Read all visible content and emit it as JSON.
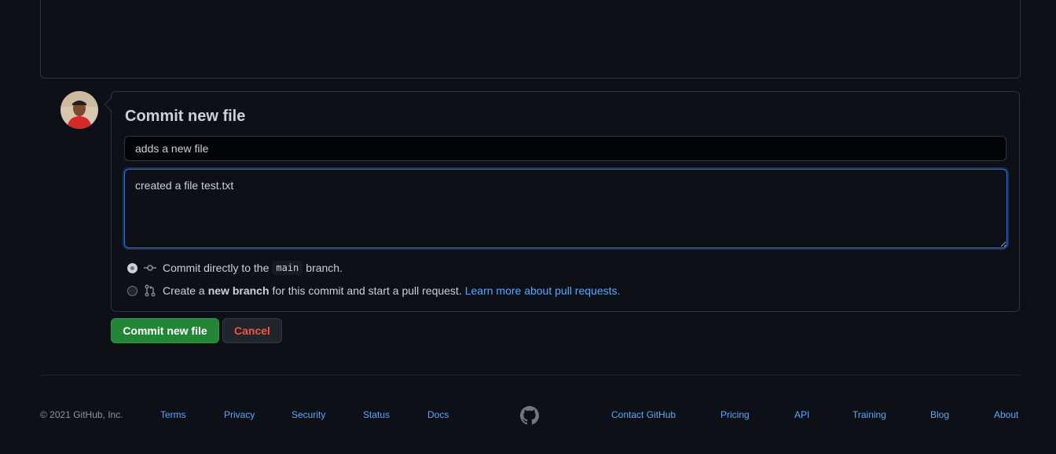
{
  "commit": {
    "title": "Commit new file",
    "summary_value": "adds a new file",
    "description_value": "created a file test.txt",
    "option_direct": {
      "prefix": "Commit directly to the",
      "branch": "main",
      "suffix": "branch."
    },
    "option_new_branch": {
      "prefix": "Create a",
      "bold": "new branch",
      "suffix": "for this commit and start a pull request.",
      "link": "Learn more about pull requests."
    },
    "commit_button": "Commit new file",
    "cancel_button": "Cancel"
  },
  "footer": {
    "copyright": "© 2021 GitHub, Inc.",
    "links_left": [
      "Terms",
      "Privacy",
      "Security",
      "Status",
      "Docs"
    ],
    "links_right": [
      "Contact GitHub",
      "Pricing",
      "API",
      "Training",
      "Blog",
      "About"
    ]
  },
  "colors": {
    "background": "#0d1117",
    "border": "#30363d",
    "accent_link": "#58a6ff",
    "primary_button": "#238636",
    "danger_text": "#f85149",
    "focus_border": "#1f6feb"
  }
}
